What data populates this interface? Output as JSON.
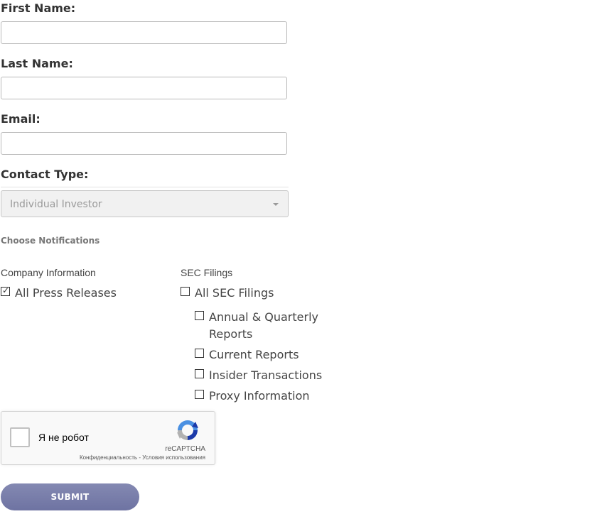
{
  "form": {
    "first_name": {
      "label": "First Name:",
      "value": "",
      "placeholder": ""
    },
    "last_name": {
      "label": "Last Name:",
      "value": "",
      "placeholder": ""
    },
    "email": {
      "label": "Email:",
      "value": "",
      "placeholder": ""
    },
    "contact_type": {
      "label": "Contact Type:",
      "selected": "Individual Investor"
    }
  },
  "notifications": {
    "heading": "Choose Notifications",
    "company_info": {
      "heading": "Company Information",
      "items": [
        {
          "label": "All Press Releases",
          "checked": true
        }
      ]
    },
    "sec_filings": {
      "heading": "SEC Filings",
      "items": [
        {
          "label": "All SEC Filings",
          "checked": false
        },
        {
          "label": "Annual & Quarterly Reports",
          "checked": false
        },
        {
          "label": "Current Reports",
          "checked": false
        },
        {
          "label": "Insider Transactions",
          "checked": false
        },
        {
          "label": "Proxy Information",
          "checked": false
        }
      ]
    }
  },
  "captcha": {
    "label": "Я не робот",
    "brand": "reCAPTCHA",
    "privacy": "Конфиденциальность",
    "separator": " - ",
    "terms": "Условия использования"
  },
  "submit": {
    "label": "SUBMIT"
  },
  "colors": {
    "submit_button": "#7a7fac",
    "input_border": "#b9b9b9",
    "select_background": "#f1f1f1"
  },
  "icons": {
    "checkbox_checked": "check-mark",
    "captcha_logo": "recaptcha-icon",
    "select_arrow": "caret-down-icon"
  }
}
